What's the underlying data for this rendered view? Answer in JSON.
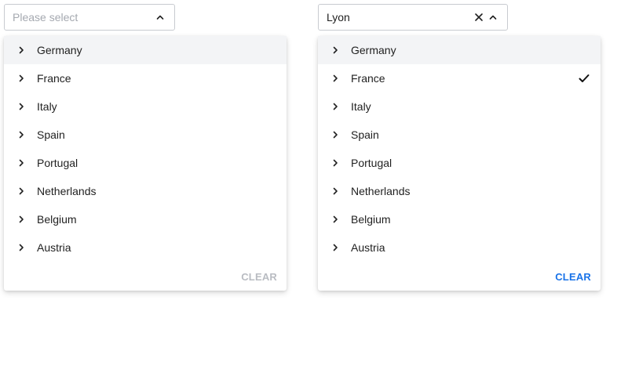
{
  "left_cascader": {
    "placeholder": "Please select",
    "options": [
      "Germany",
      "France",
      "Italy",
      "Spain",
      "Portugal",
      "Netherlands",
      "Belgium",
      "Austria"
    ],
    "hovered_option": "Germany",
    "clear_label": "CLEAR",
    "clear_enabled": false
  },
  "right_cascader": {
    "value": "Lyon",
    "options": [
      "Germany",
      "France",
      "Italy",
      "Spain",
      "Portugal",
      "Netherlands",
      "Belgium",
      "Austria"
    ],
    "hovered_option": "Germany",
    "selected_option": "France",
    "clear_label": "CLEAR",
    "clear_enabled": true
  },
  "colors": {
    "accent": "#1a73e8",
    "disabled_text": "#b9bcc2",
    "placeholder_text": "#a5a9b0",
    "hover_background": "#f3f4f6",
    "border": "#c8cbd0"
  },
  "icons": {
    "expand": "chevron-up-icon",
    "option_arrow": "chevron-right-icon",
    "clear_value": "close-icon",
    "selected": "check-icon"
  }
}
